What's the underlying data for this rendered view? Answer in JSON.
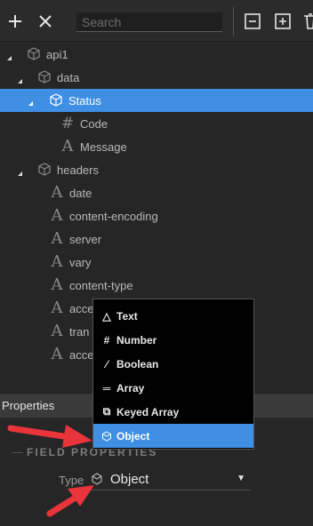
{
  "toolbar": {
    "add_icon": "plus-icon",
    "close_icon": "close-icon",
    "search_placeholder": "Search",
    "collapse_icon": "minus-square-icon",
    "expand_icon": "plus-square-icon",
    "delete_icon": "trash-icon"
  },
  "tree": [
    {
      "label": "api1",
      "icon": "cube-icon"
    },
    {
      "label": "data",
      "icon": "cube-icon"
    },
    {
      "label": "Status",
      "icon": "cube-icon",
      "selected": true
    },
    {
      "label": "Code",
      "icon": "number-icon"
    },
    {
      "label": "Message",
      "icon": "text-icon"
    },
    {
      "label": "headers",
      "icon": "cube-icon"
    },
    {
      "label": "date",
      "icon": "text-icon"
    },
    {
      "label": "content-encoding",
      "icon": "text-icon"
    },
    {
      "label": "server",
      "icon": "text-icon"
    },
    {
      "label": "vary",
      "icon": "text-icon"
    },
    {
      "label": "content-type",
      "icon": "text-icon"
    },
    {
      "label": "acce",
      "icon": "text-icon"
    },
    {
      "label": "tran",
      "icon": "text-icon"
    },
    {
      "label": "acce",
      "icon": "text-icon"
    }
  ],
  "properties": {
    "header": "Properties",
    "section_title": "FIELD PROPERTIES",
    "type_label": "Type",
    "type_value": "Object"
  },
  "dropdown": {
    "items": [
      {
        "label": "Text",
        "icon": "text-icon"
      },
      {
        "label": "Number",
        "icon": "number-icon"
      },
      {
        "label": "Boolean",
        "icon": "boolean-icon"
      },
      {
        "label": "Array",
        "icon": "array-icon"
      },
      {
        "label": "Keyed Array",
        "icon": "keyed-array-icon"
      },
      {
        "label": "Object",
        "icon": "cube-icon",
        "active": true
      }
    ]
  },
  "colors": {
    "selection": "#3f8fe5",
    "annotation_arrow": "#e8343a",
    "background": "#262626"
  }
}
